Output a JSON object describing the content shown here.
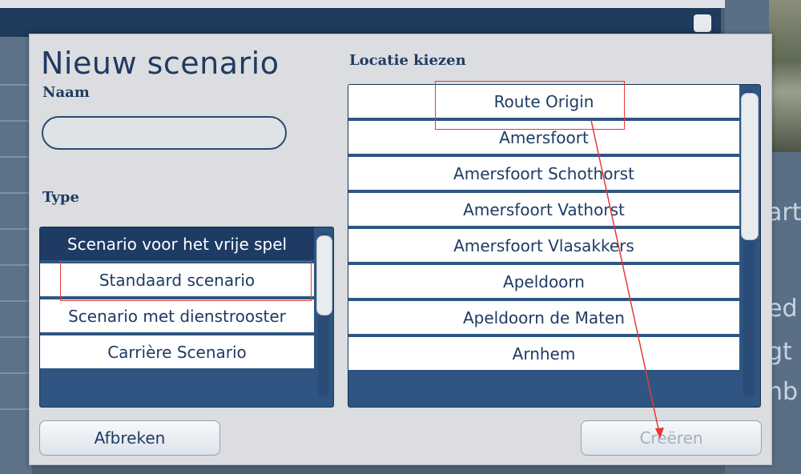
{
  "dialog": {
    "title": "Nieuw scenario",
    "name_label": "Naam",
    "name_value": "",
    "type_label": "Type",
    "location_label": "Locatie kiezen"
  },
  "type_list": {
    "items": [
      {
        "label": "Scenario voor het vrije spel",
        "selected": true
      },
      {
        "label": "Standaard scenario",
        "selected": false
      },
      {
        "label": "Scenario met dienstrooster",
        "selected": false
      },
      {
        "label": "Carrière Scenario",
        "selected": false
      }
    ]
  },
  "location_list": {
    "items": [
      {
        "label": "Route Origin"
      },
      {
        "label": "Amersfoort"
      },
      {
        "label": "Amersfoort Schothorst"
      },
      {
        "label": "Amersfoort Vathorst"
      },
      {
        "label": "Amersfoort Vlasakkers"
      },
      {
        "label": "Apeldoorn"
      },
      {
        "label": "Apeldoorn de Maten"
      },
      {
        "label": "Arnhem"
      }
    ]
  },
  "buttons": {
    "cancel": "Afbreken",
    "create": "Creëren"
  },
  "background": {
    "text_1": "art",
    "text_2": "ed",
    "text_3": "gt",
    "text_4": "nb"
  },
  "colors": {
    "accent": "#1f3b63",
    "selected_bg": "#1e3b64",
    "list_bg": "#2f5682",
    "annotation": "#e53935"
  }
}
